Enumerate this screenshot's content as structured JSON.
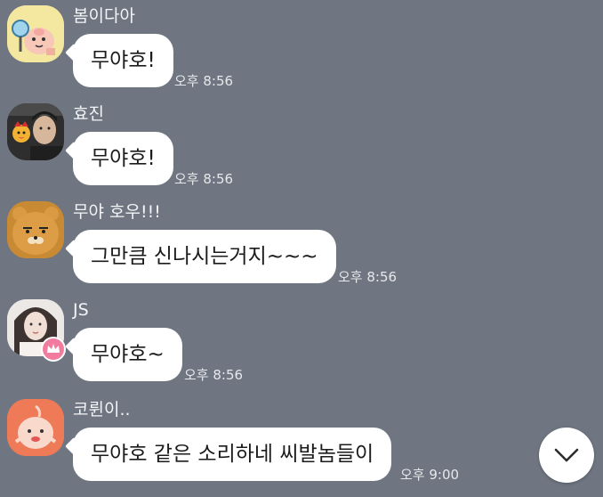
{
  "messages": [
    {
      "sender": "봄이다아",
      "text": "무야호!",
      "time": "오후 8:56",
      "avatar": "apeach-fan-icon"
    },
    {
      "sender": "효진",
      "text": "무야호!",
      "time": "오후 8:56",
      "avatar": "photo-with-character-icon"
    },
    {
      "sender": "무야 호우!!!",
      "text": "그만큼 신나시는거지~~~",
      "time": "오후 8:56",
      "avatar": "ryan-character-icon"
    },
    {
      "sender": "JS",
      "text": "무야호~",
      "time": "오후 8:56",
      "avatar": "girl-photo-icon"
    },
    {
      "sender": "코륀이..",
      "text": "무야호 같은 소리하네 씨발놈들이",
      "time": "오후 9:00",
      "avatar": "apeach-character-icon"
    }
  ],
  "scroll_button": {
    "icon": "chevron-down-icon"
  },
  "colors": {
    "background": "#6f7681",
    "bubble": "#ffffff",
    "text": "#1b1b1b"
  }
}
